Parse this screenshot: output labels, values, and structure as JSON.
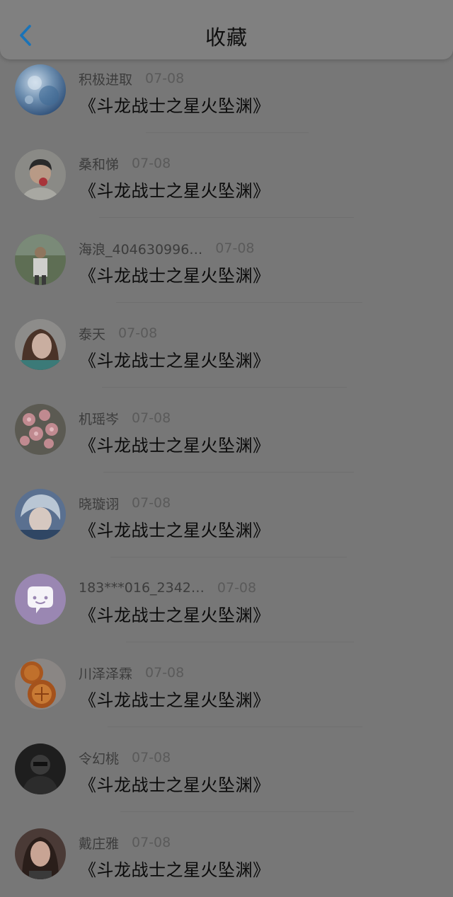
{
  "header": {
    "title": "收藏",
    "back_icon": "chevron-left-icon",
    "back_color": "#1a73b8"
  },
  "items": [
    {
      "username": "积极进取",
      "date": "07-08",
      "book": "《斗龙战士之星火坠渊》",
      "avatar": "blue-sphere"
    },
    {
      "username": "桑和悌",
      "date": "07-08",
      "book": "《斗龙战士之星火坠渊》",
      "avatar": "child-with-flower"
    },
    {
      "username": "海浪_404630996…",
      "date": "07-08",
      "book": "《斗龙战士之星火坠渊》",
      "avatar": "man-outdoors"
    },
    {
      "username": "泰天",
      "date": "07-08",
      "book": "《斗龙战士之星火坠渊》",
      "avatar": "girl-portrait"
    },
    {
      "username": "机瑶岑",
      "date": "07-08",
      "book": "《斗龙战士之星火坠渊》",
      "avatar": "pink-flowers"
    },
    {
      "username": "晓璇诩",
      "date": "07-08",
      "book": "《斗龙战士之星火坠渊》",
      "avatar": "anime-character"
    },
    {
      "username": "183***016_2342…",
      "date": "07-08",
      "book": "《斗龙战士之星火坠渊》",
      "avatar": "default-chat-bubble"
    },
    {
      "username": "川泽泽霖",
      "date": "07-08",
      "book": "《斗龙战士之星火坠渊》",
      "avatar": "mooncakes"
    },
    {
      "username": "令幻桃",
      "date": "07-08",
      "book": "《斗龙战士之星火坠渊》",
      "avatar": "dark-figure"
    },
    {
      "username": "戴庄雅",
      "date": "07-08",
      "book": "《斗龙战士之星火坠渊》",
      "avatar": "woman-portrait"
    }
  ]
}
